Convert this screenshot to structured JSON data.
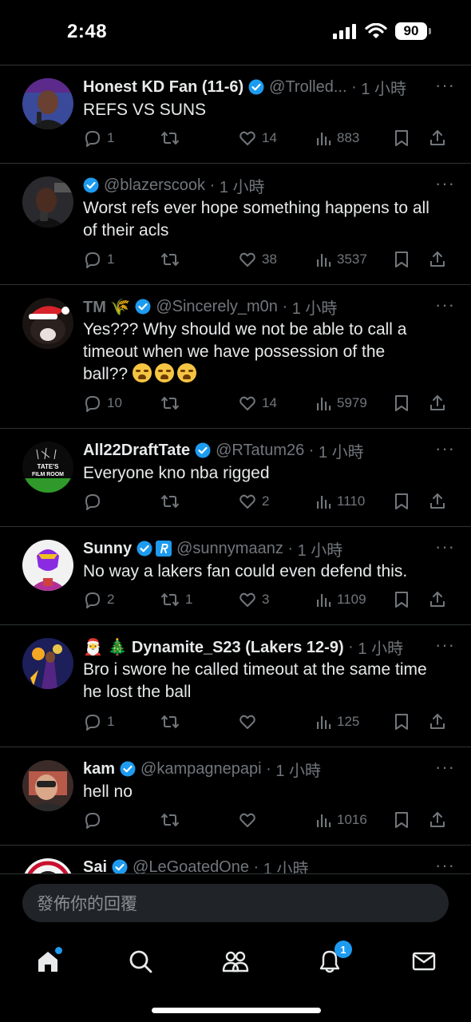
{
  "status": {
    "time": "2:48",
    "battery": "90"
  },
  "tweets": [
    {
      "name": "Honest KD Fan (11-6)",
      "handle": "@Trolled...",
      "time": "1 小時",
      "text_lines": [
        "REFS VS SUNS"
      ],
      "replies": "1",
      "retweets": "",
      "likes": "14",
      "views": "883"
    },
    {
      "name": "",
      "handle": "@blazerscook",
      "time": "1 小時",
      "text_lines": [
        "Worst refs ever hope something happens to all",
        "of their acls"
      ],
      "replies": "1",
      "retweets": "",
      "likes": "38",
      "views": "3537"
    },
    {
      "name": "TM 🌾",
      "handle": "@Sincerely_m0n",
      "time": "1 小時",
      "text_lines": [
        "Yes??? Why should we not be able to call a",
        "timeout when we have possession of the",
        "ball??"
      ],
      "replies": "10",
      "retweets": "",
      "likes": "14",
      "views": "5979"
    },
    {
      "name": "All22DraftTate",
      "handle": "@RTatum26",
      "time": "1 小時",
      "text_lines": [
        "Everyone kno nba rigged"
      ],
      "replies": "",
      "retweets": "",
      "likes": "2",
      "views": "1110"
    },
    {
      "name": "Sunny",
      "handle": "@sunnymaanz",
      "time": "1 小時",
      "text_lines": [
        "No way a lakers fan could even defend this."
      ],
      "replies": "2",
      "retweets": "1",
      "likes": "3",
      "views": "1109"
    },
    {
      "name": "🎅 🎄 Dynamite_S23 (Lakers 12-9)",
      "handle": "",
      "time": "1 小時",
      "text_lines": [
        "Bro i swore he called timeout at the same time",
        "he lost the ball"
      ],
      "replies": "1",
      "retweets": "",
      "likes": "",
      "views": "125"
    },
    {
      "name": "kam",
      "handle": "@kampagnepapi",
      "time": "1 小時",
      "text_lines": [
        "hell no"
      ],
      "replies": "",
      "retweets": "",
      "likes": "",
      "views": "1016"
    },
    {
      "name": "Sai",
      "handle": "@LeGoatedOne",
      "time": "1 小時",
      "text_lines": [],
      "replies": "",
      "retweets": "",
      "likes": "",
      "views": ""
    }
  ],
  "more_glyph": "···",
  "avatar_text": {
    "tate_line1": "TATE'S",
    "tate_line2": "FILM ROOM"
  },
  "reply_placeholder": "發佈你的回覆",
  "nav": {
    "notifications_badge": "1"
  },
  "colors": {
    "accent": "#1d9bf0",
    "background": "#000000",
    "muted": "#71767b",
    "divider": "#2f3336"
  }
}
